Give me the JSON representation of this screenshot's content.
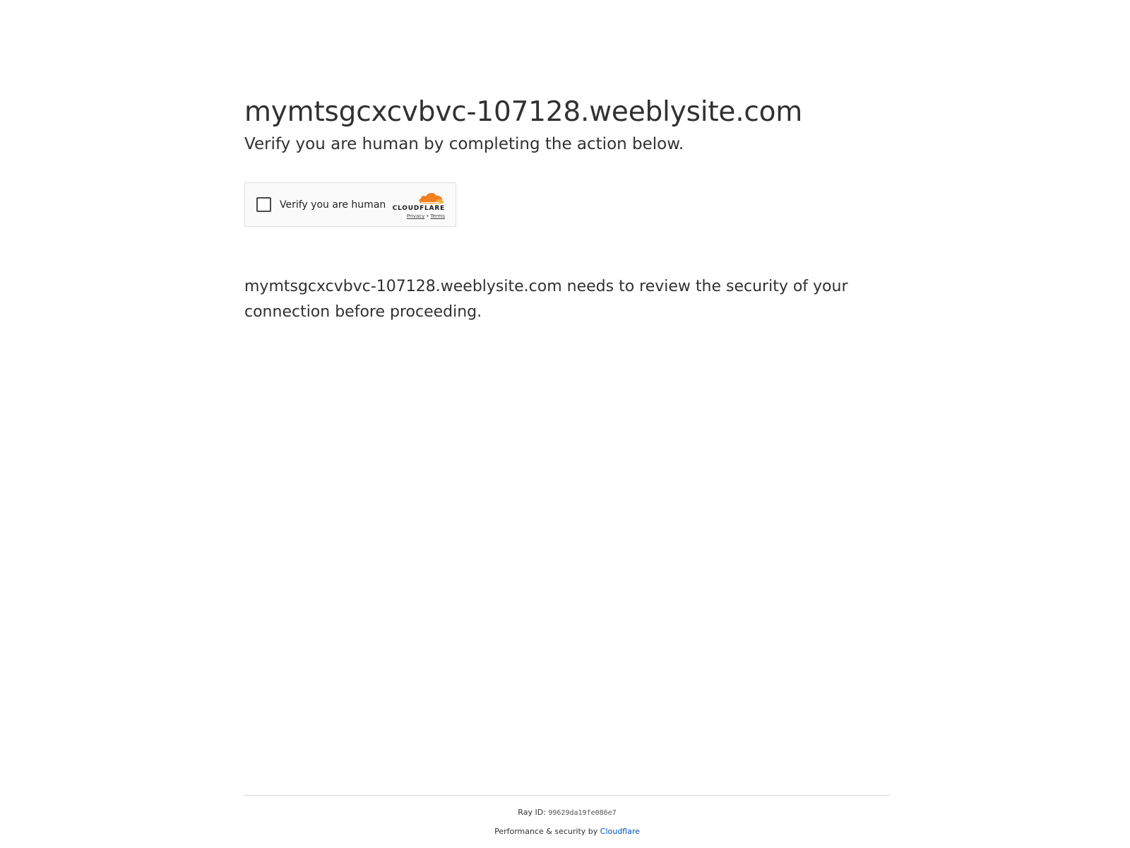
{
  "header": {
    "site_domain": "mymtsgcxcvbvc-107128.weeblysite.com",
    "subtitle": "Verify you are human by completing the action below."
  },
  "challenge_widget": {
    "checkbox_label": "Verify you are human",
    "brand_wordmark": "CLOUDFLARE",
    "privacy_link": "Privacy",
    "separator": "•",
    "terms_link": "Terms",
    "checked": false,
    "icons": {
      "checkbox": "checkbox-icon",
      "brand": "cloudflare-cloud-icon"
    },
    "colors": {
      "cloud_orange": "#f38020",
      "cloud_light": "#faae40"
    }
  },
  "body": {
    "security_message": "mymtsgcxcvbvc-107128.weeblysite.com needs to review the security of your connection before proceeding."
  },
  "footer": {
    "ray_label": "Ray ID:",
    "ray_id": "99629da19fe086e7",
    "performance_prefix": "Performance & security by",
    "performance_link": "Cloudflare",
    "link_color": "#0051c3"
  }
}
